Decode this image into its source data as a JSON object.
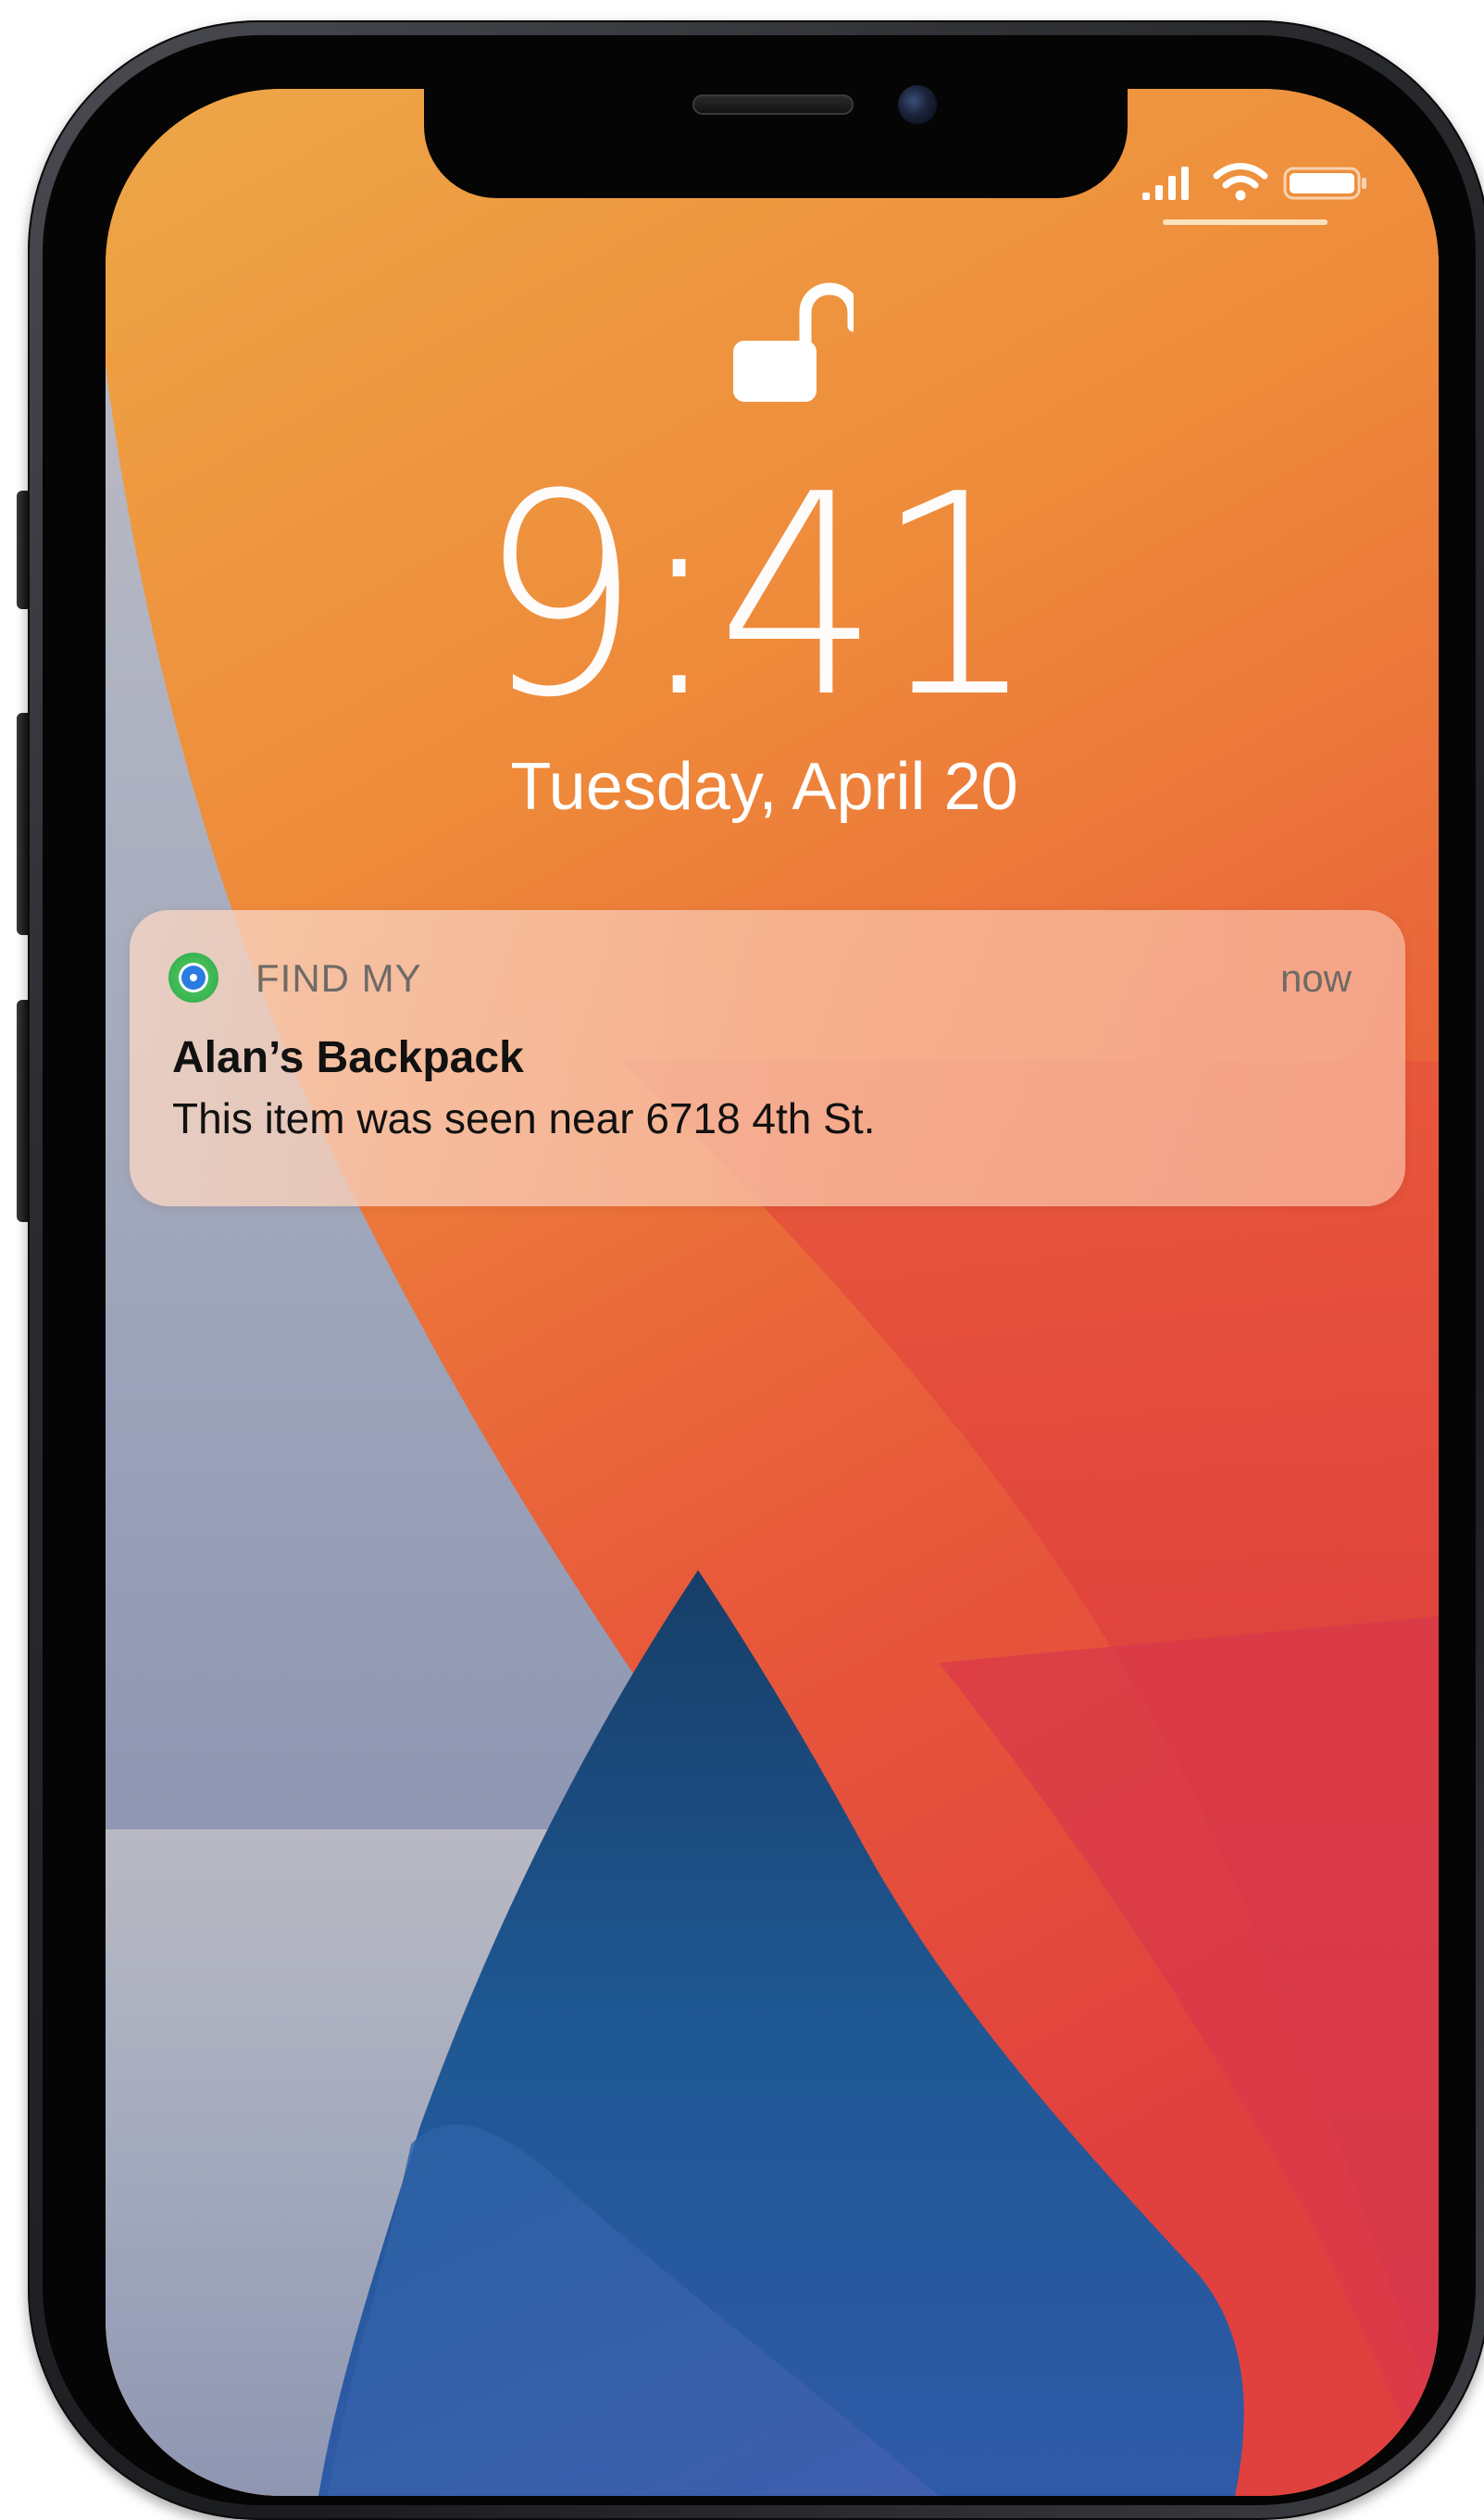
{
  "status_bar": {
    "signal_icon": "cellular-signal-icon",
    "wifi_icon": "wifi-icon",
    "battery_icon": "battery-icon"
  },
  "lock_screen": {
    "lock_icon": "unlocked-padlock-icon",
    "time": "9:41",
    "date": "Tuesday, April 20"
  },
  "notification": {
    "app_icon": "find-my-app-icon",
    "app_name": "FIND MY",
    "time": "now",
    "title": "Alan’s Backpack",
    "body": "This item was seen near 6718 4th St."
  },
  "colors": {
    "wallpaper_orange": "#F19B3B",
    "wallpaper_red": "#E0443C",
    "wallpaper_blue": "#1F5A94",
    "wallpaper_slate": "#9FA8BE",
    "notification_bg": "#F7BFA4",
    "find_my_green": "#3BB551"
  }
}
